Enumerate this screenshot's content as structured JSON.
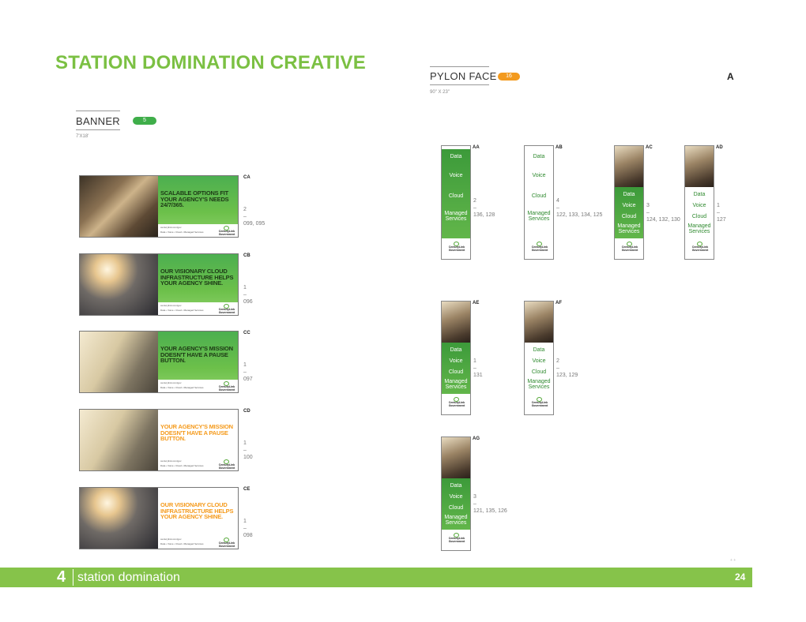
{
  "page": {
    "title": "STATION DOMINATION CREATIVE",
    "corner_letter": "A",
    "tiny_mark": "+ +"
  },
  "banner_section": {
    "label": "BANNER",
    "count": "5",
    "dims": "7'X18'",
    "pill_color": "#3fae4a"
  },
  "pylon_section": {
    "label": "PYLON FACE",
    "count": "16",
    "dims": "90\" X 23\"",
    "pill_color": "#f39a1e"
  },
  "banners": [
    {
      "code": "CA",
      "headline": "SCALABLE OPTIONS FIT YOUR AGENCY'S NEEDS 24/7/365.",
      "qty": "2",
      "dash": "–",
      "stations": "099, 095",
      "style": "green",
      "url": "centurylink.com/gov",
      "tagline": "Data • Voice • Cloud • Managed Services",
      "logo": "CenturyLink Government"
    },
    {
      "code": "CB",
      "headline": "OUR VISIONARY CLOUD INFRASTRUCTURE HELPS YOUR AGENCY SHINE.",
      "qty": "1",
      "dash": "–",
      "stations": "096",
      "style": "green",
      "url": "centurylink.com/gov",
      "tagline": "Data • Voice • Cloud • Managed Services",
      "logo": "CenturyLink Government"
    },
    {
      "code": "CC",
      "headline": "YOUR AGENCY'S MISSION DOESN'T HAVE A PAUSE BUTTON.",
      "qty": "1",
      "dash": "–",
      "stations": "097",
      "style": "green",
      "url": "centurylink.com/gov",
      "tagline": "Data • Voice • Cloud • Managed Services",
      "logo": "CenturyLink Government"
    },
    {
      "code": "CD",
      "headline": "YOUR AGENCY'S MISSION DOESN'T HAVE A PAUSE BUTTON.",
      "qty": "1",
      "dash": "–",
      "stations": "100",
      "style": "white",
      "url": "centurylink.com/gov",
      "tagline": "Data • Voice • Cloud • Managed Services",
      "logo": "CenturyLink Government"
    },
    {
      "code": "CE",
      "headline": "OUR VISIONARY CLOUD INFRASTRUCTURE HELPS YOUR AGENCY SHINE.",
      "qty": "1",
      "dash": "–",
      "stations": "098",
      "style": "white",
      "url": "centurylink.com/gov",
      "tagline": "Data • Voice • Cloud • Managed Services",
      "logo": "CenturyLink Government"
    }
  ],
  "pylons": [
    {
      "code": "AA",
      "qty": "2",
      "dash": "–",
      "stations": "136, 128",
      "w1": "Data",
      "w2": "Voice",
      "w3": "Cloud",
      "w4": "Managed",
      "w5": "Services",
      "logo": "CenturyLink Government"
    },
    {
      "code": "AB",
      "qty": "4",
      "dash": "–",
      "stations": "122, 133, 134, 125",
      "w1": "Data",
      "w2": "Voice",
      "w3": "Cloud",
      "w4": "Managed",
      "w5": "Services",
      "logo": "CenturyLink Government"
    },
    {
      "code": "AC",
      "qty": "3",
      "dash": "–",
      "stations": "124, 132, 130",
      "w1": "Data",
      "w2": "Voice",
      "w3": "Cloud",
      "w4": "Managed",
      "w5": "Services",
      "logo": "CenturyLink Government"
    },
    {
      "code": "AD",
      "qty": "1",
      "dash": "–",
      "stations": "127",
      "w1": "Data",
      "w2": "Voice",
      "w3": "Cloud",
      "w4": "Managed",
      "w5": "Services",
      "logo": "CenturyLink Government"
    },
    {
      "code": "AE",
      "qty": "1",
      "dash": "–",
      "stations": "131",
      "w1": "Data",
      "w2": "Voice",
      "w3": "Cloud",
      "w4": "Managed",
      "w5": "Services",
      "logo": "CenturyLink Government"
    },
    {
      "code": "AF",
      "qty": "2",
      "dash": "–",
      "stations": "123, 129",
      "w1": "Data",
      "w2": "Voice",
      "w3": "Cloud",
      "w4": "Managed",
      "w5": "Services",
      "logo": "CenturyLink Government"
    },
    {
      "code": "AG",
      "qty": "3",
      "dash": "–",
      "stations": "121, 135, 126",
      "w1": "Data",
      "w2": "Voice",
      "w3": "Cloud",
      "w4": "Managed",
      "w5": "Services",
      "logo": "CenturyLink Government"
    }
  ],
  "footer": {
    "section_number": "4",
    "section_label": "station domination",
    "page_number": "24"
  },
  "colors": {
    "brand_green": "#7bc043",
    "accent_orange": "#f59a1b"
  }
}
